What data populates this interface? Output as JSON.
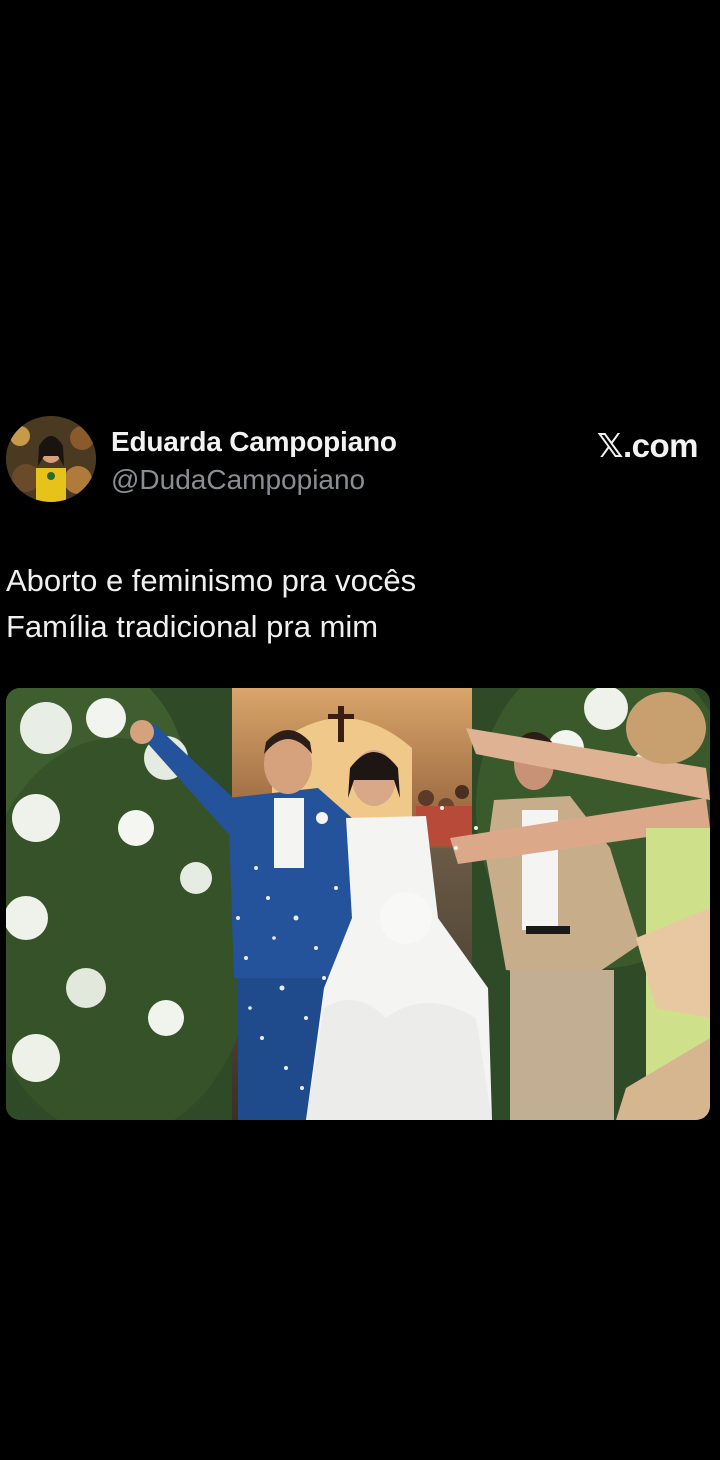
{
  "author": {
    "name": "Eduarda Campopiano",
    "handle": "@DudaCampopiano",
    "avatar_icon": "profile-photo"
  },
  "brand": {
    "logo": "𝕏",
    "suffix": ".com"
  },
  "post": {
    "lines": [
      "Aborto e feminismo pra vocês",
      "Família tradicional pra mim"
    ]
  },
  "media": {
    "description_icon": "wedding-photo"
  },
  "colors": {
    "background": "#000000",
    "text": "#f0f0f0",
    "handle": "#8a8d91",
    "suit_blue": "#24539c",
    "dress_white": "#f4f4f2"
  }
}
